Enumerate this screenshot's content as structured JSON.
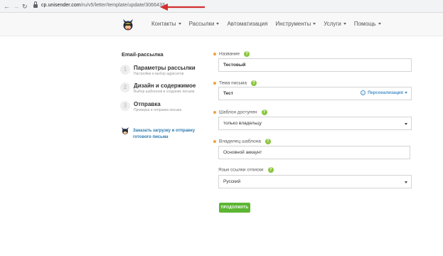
{
  "browser": {
    "back_icon": "arrow-left-icon",
    "forward_icon": "arrow-right-icon",
    "reload_icon": "reload-icon",
    "url_host": "cp.unisender.com",
    "url_path": "/ru/v5/letter/template/update/3066433"
  },
  "header": {
    "nav": [
      {
        "label": "Контакты",
        "dropdown": true
      },
      {
        "label": "Рассылки",
        "dropdown": true
      },
      {
        "label": "Автоматизация",
        "dropdown": false
      },
      {
        "label": "Инструменты",
        "dropdown": true
      },
      {
        "label": "Услуги",
        "dropdown": true
      },
      {
        "label": "Помощь",
        "dropdown": true
      }
    ]
  },
  "sidebar": {
    "title": "Email-рассылка",
    "steps": [
      {
        "num": "1",
        "title": "Параметры рассылки",
        "sub": "Настройки и выбор адресатов"
      },
      {
        "num": "2",
        "title": "Дизайн и содержимое",
        "sub": "Выбор шаблонов и создание письма"
      },
      {
        "num": "3",
        "title": "Отправка",
        "sub": "Проверка и отправка письма"
      }
    ],
    "order_link": "Заказать загрузку и отправку готового письма"
  },
  "form": {
    "name_label": "Название",
    "name_value": "Тестовый",
    "subject_label": "Тема письма",
    "subject_value": "Тест",
    "personalization_label": "Персонализация",
    "access_label": "Шаблон доступен",
    "access_value": "только владельцу",
    "owner_label": "Владелец шаблона",
    "owner_value": "Основной аккаунт",
    "lang_label": "Язык ссылки отписки",
    "lang_value": "Русский",
    "help_glyph": "?",
    "submit_label": "ПРОДОЛЖИТЬ"
  },
  "colors": {
    "accent_green": "#5cb634",
    "help_green": "#8cc63f",
    "required_orange": "#f0a040",
    "link_blue": "#2a7ab0",
    "annotation_red": "#d32f2f"
  }
}
